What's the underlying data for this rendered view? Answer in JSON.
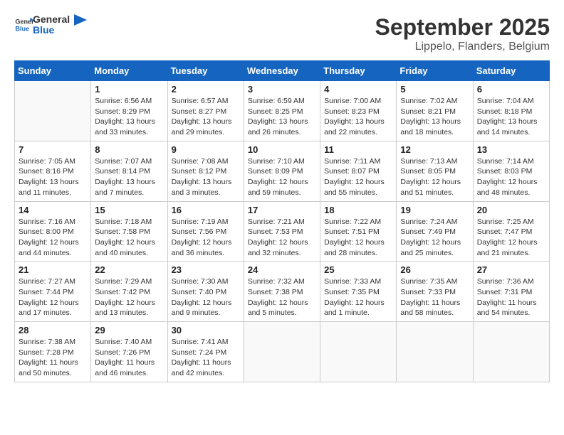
{
  "logo": {
    "text_general": "General",
    "text_blue": "Blue"
  },
  "title": "September 2025",
  "subtitle": "Lippelo, Flanders, Belgium",
  "days_of_week": [
    "Sunday",
    "Monday",
    "Tuesday",
    "Wednesday",
    "Thursday",
    "Friday",
    "Saturday"
  ],
  "weeks": [
    [
      {
        "day": "",
        "info": ""
      },
      {
        "day": "1",
        "info": "Sunrise: 6:56 AM\nSunset: 8:29 PM\nDaylight: 13 hours\nand 33 minutes."
      },
      {
        "day": "2",
        "info": "Sunrise: 6:57 AM\nSunset: 8:27 PM\nDaylight: 13 hours\nand 29 minutes."
      },
      {
        "day": "3",
        "info": "Sunrise: 6:59 AM\nSunset: 8:25 PM\nDaylight: 13 hours\nand 26 minutes."
      },
      {
        "day": "4",
        "info": "Sunrise: 7:00 AM\nSunset: 8:23 PM\nDaylight: 13 hours\nand 22 minutes."
      },
      {
        "day": "5",
        "info": "Sunrise: 7:02 AM\nSunset: 8:21 PM\nDaylight: 13 hours\nand 18 minutes."
      },
      {
        "day": "6",
        "info": "Sunrise: 7:04 AM\nSunset: 8:18 PM\nDaylight: 13 hours\nand 14 minutes."
      }
    ],
    [
      {
        "day": "7",
        "info": "Sunrise: 7:05 AM\nSunset: 8:16 PM\nDaylight: 13 hours\nand 11 minutes."
      },
      {
        "day": "8",
        "info": "Sunrise: 7:07 AM\nSunset: 8:14 PM\nDaylight: 13 hours\nand 7 minutes."
      },
      {
        "day": "9",
        "info": "Sunrise: 7:08 AM\nSunset: 8:12 PM\nDaylight: 13 hours\nand 3 minutes."
      },
      {
        "day": "10",
        "info": "Sunrise: 7:10 AM\nSunset: 8:09 PM\nDaylight: 12 hours\nand 59 minutes."
      },
      {
        "day": "11",
        "info": "Sunrise: 7:11 AM\nSunset: 8:07 PM\nDaylight: 12 hours\nand 55 minutes."
      },
      {
        "day": "12",
        "info": "Sunrise: 7:13 AM\nSunset: 8:05 PM\nDaylight: 12 hours\nand 51 minutes."
      },
      {
        "day": "13",
        "info": "Sunrise: 7:14 AM\nSunset: 8:03 PM\nDaylight: 12 hours\nand 48 minutes."
      }
    ],
    [
      {
        "day": "14",
        "info": "Sunrise: 7:16 AM\nSunset: 8:00 PM\nDaylight: 12 hours\nand 44 minutes."
      },
      {
        "day": "15",
        "info": "Sunrise: 7:18 AM\nSunset: 7:58 PM\nDaylight: 12 hours\nand 40 minutes."
      },
      {
        "day": "16",
        "info": "Sunrise: 7:19 AM\nSunset: 7:56 PM\nDaylight: 12 hours\nand 36 minutes."
      },
      {
        "day": "17",
        "info": "Sunrise: 7:21 AM\nSunset: 7:53 PM\nDaylight: 12 hours\nand 32 minutes."
      },
      {
        "day": "18",
        "info": "Sunrise: 7:22 AM\nSunset: 7:51 PM\nDaylight: 12 hours\nand 28 minutes."
      },
      {
        "day": "19",
        "info": "Sunrise: 7:24 AM\nSunset: 7:49 PM\nDaylight: 12 hours\nand 25 minutes."
      },
      {
        "day": "20",
        "info": "Sunrise: 7:25 AM\nSunset: 7:47 PM\nDaylight: 12 hours\nand 21 minutes."
      }
    ],
    [
      {
        "day": "21",
        "info": "Sunrise: 7:27 AM\nSunset: 7:44 PM\nDaylight: 12 hours\nand 17 minutes."
      },
      {
        "day": "22",
        "info": "Sunrise: 7:29 AM\nSunset: 7:42 PM\nDaylight: 12 hours\nand 13 minutes."
      },
      {
        "day": "23",
        "info": "Sunrise: 7:30 AM\nSunset: 7:40 PM\nDaylight: 12 hours\nand 9 minutes."
      },
      {
        "day": "24",
        "info": "Sunrise: 7:32 AM\nSunset: 7:38 PM\nDaylight: 12 hours\nand 5 minutes."
      },
      {
        "day": "25",
        "info": "Sunrise: 7:33 AM\nSunset: 7:35 PM\nDaylight: 12 hours\nand 1 minute."
      },
      {
        "day": "26",
        "info": "Sunrise: 7:35 AM\nSunset: 7:33 PM\nDaylight: 11 hours\nand 58 minutes."
      },
      {
        "day": "27",
        "info": "Sunrise: 7:36 AM\nSunset: 7:31 PM\nDaylight: 11 hours\nand 54 minutes."
      }
    ],
    [
      {
        "day": "28",
        "info": "Sunrise: 7:38 AM\nSunset: 7:28 PM\nDaylight: 11 hours\nand 50 minutes."
      },
      {
        "day": "29",
        "info": "Sunrise: 7:40 AM\nSunset: 7:26 PM\nDaylight: 11 hours\nand 46 minutes."
      },
      {
        "day": "30",
        "info": "Sunrise: 7:41 AM\nSunset: 7:24 PM\nDaylight: 11 hours\nand 42 minutes."
      },
      {
        "day": "",
        "info": ""
      },
      {
        "day": "",
        "info": ""
      },
      {
        "day": "",
        "info": ""
      },
      {
        "day": "",
        "info": ""
      }
    ]
  ]
}
